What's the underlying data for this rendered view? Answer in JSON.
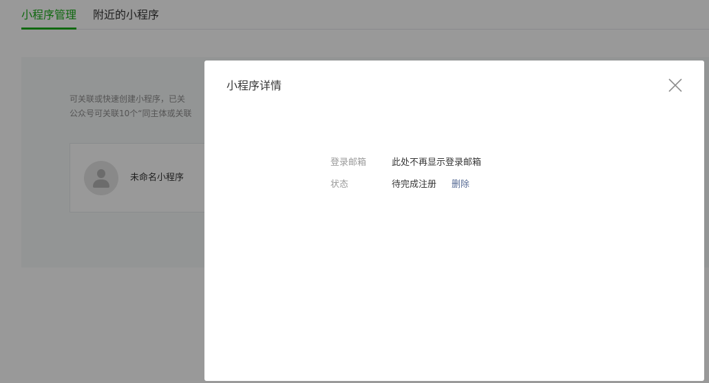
{
  "tabs": [
    {
      "label": "小程序管理",
      "active": true
    },
    {
      "label": "附近的小程序",
      "active": false
    }
  ],
  "panel": {
    "description_lines": [
      "可关联或快速创建小程序，已关",
      "公众号可关联10个“同主体或关联"
    ],
    "miniprogram": {
      "name": "未命名小程序",
      "avatar_icon": "user-avatar-icon"
    }
  },
  "dialog": {
    "title": "小程序详情",
    "close_icon": "close-icon",
    "rows": [
      {
        "label": "登录邮箱",
        "value": "此处不再显示登录邮箱"
      },
      {
        "label": "状态",
        "value": "待完成注册",
        "action": "删除"
      }
    ]
  },
  "colors": {
    "accent": "#1aad19",
    "link": "#576b95",
    "overlay": "rgba(0,0,0,0.4)"
  }
}
